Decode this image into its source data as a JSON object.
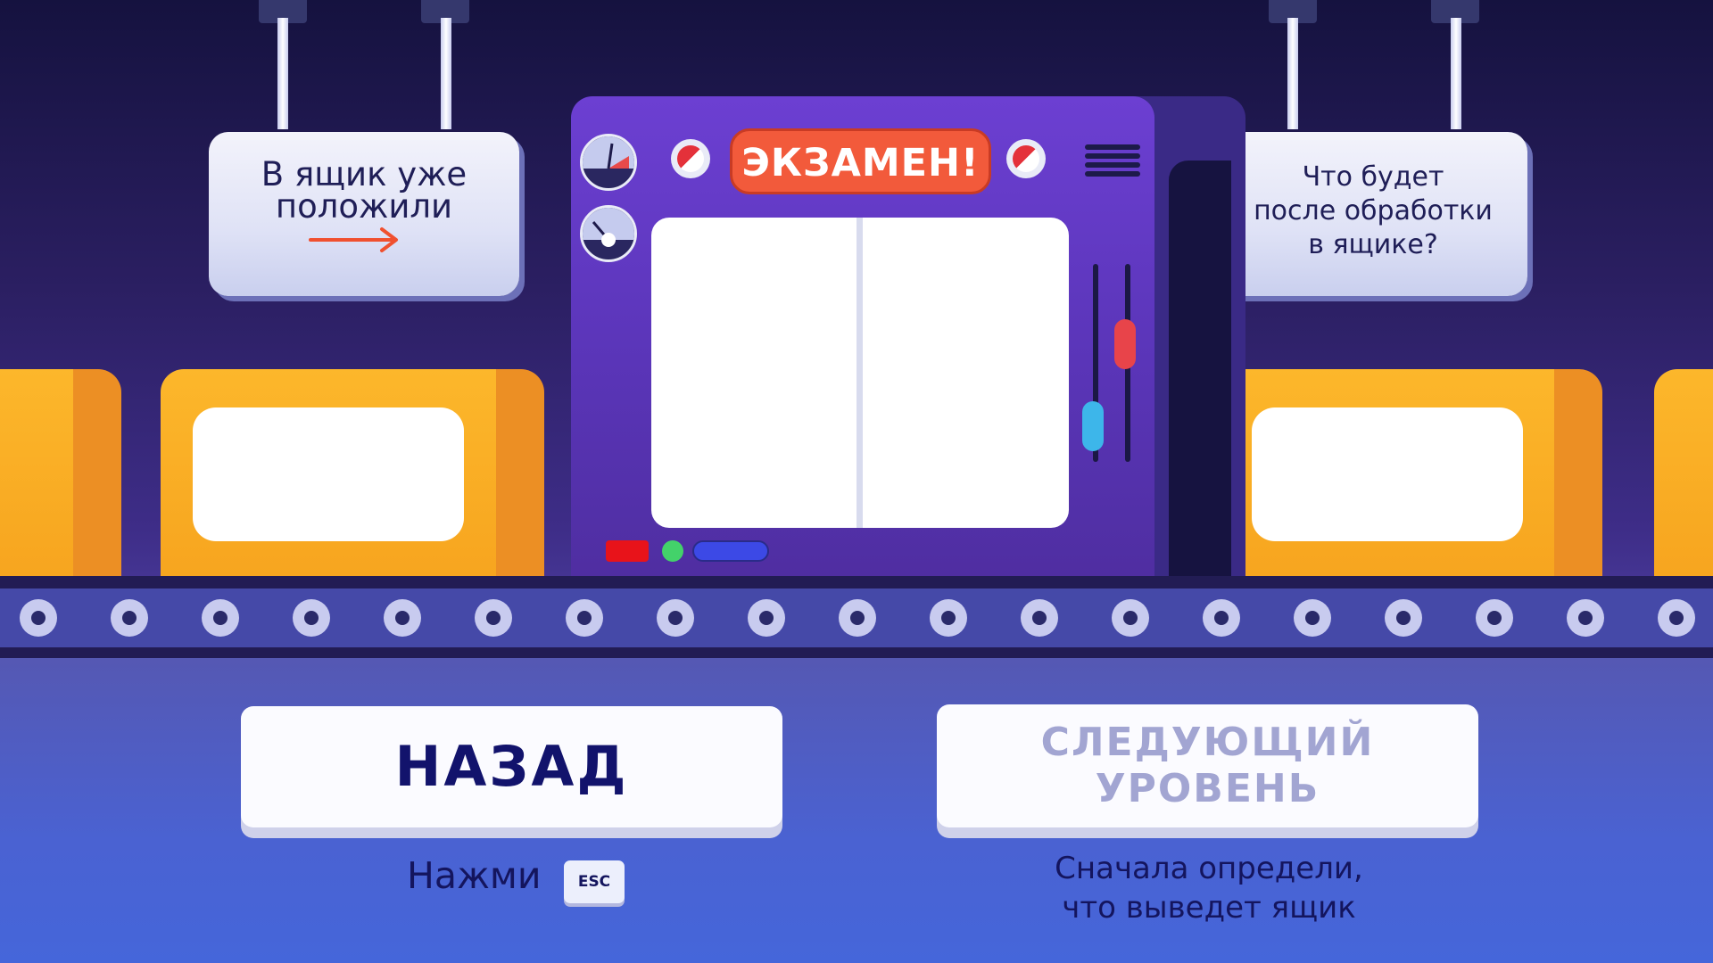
{
  "sign_left": {
    "line1": "В ящик уже",
    "line2": "положили",
    "arrow_icon": "arrow-right-icon"
  },
  "sign_right": {
    "line1": "Что будет",
    "line2": "после обработки",
    "line3": "в ящике?"
  },
  "machine": {
    "badge": "ЭКЗАМЕН!"
  },
  "buttons": {
    "back_label": "НАЗАД",
    "next_label_line1": "СЛЕДУЮЩИЙ",
    "next_label_line2": "УРОВЕНЬ"
  },
  "hints": {
    "press": "Нажми",
    "esc_key": "ESC",
    "next_line1": "Сначала определи,",
    "next_line2": "что выведет ящик"
  },
  "colors": {
    "accent_red": "#f25a3b",
    "box_orange": "#fcb72b",
    "text_dark": "#14155e",
    "disabled_text": "#a2a5d2"
  }
}
